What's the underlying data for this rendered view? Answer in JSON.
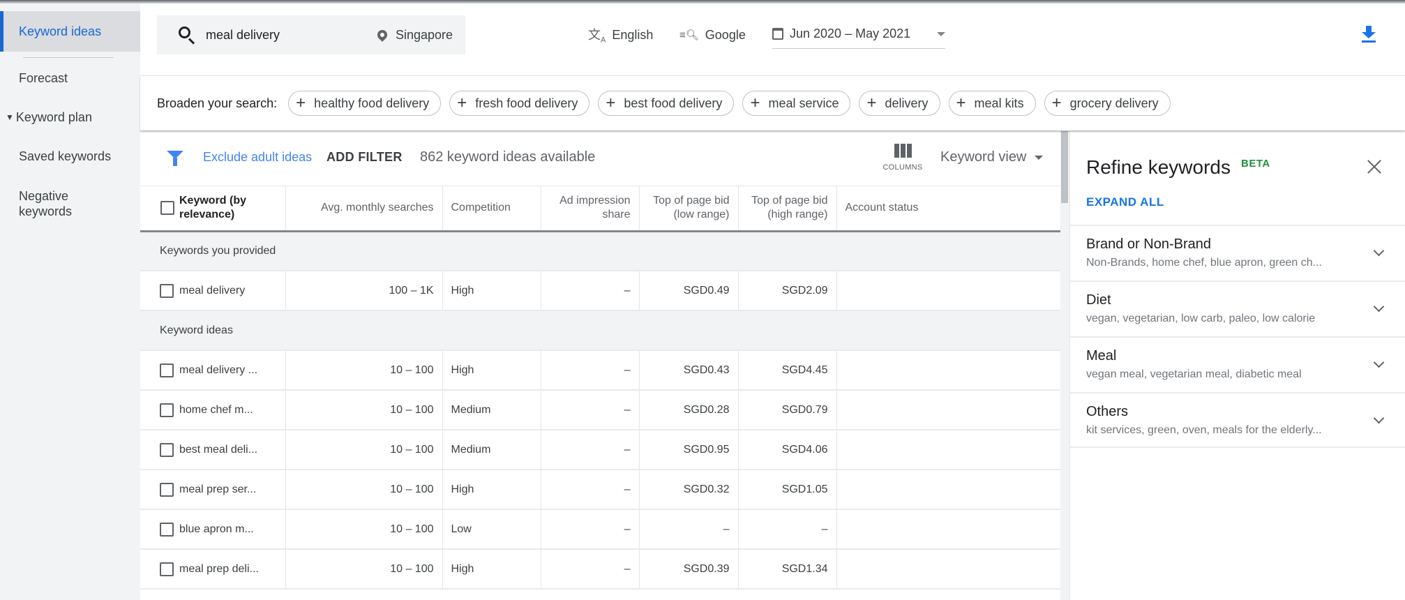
{
  "sidebar": {
    "items": [
      {
        "label": "Keyword ideas",
        "active": true
      },
      {
        "label": "Forecast"
      },
      {
        "label": "Keyword plan",
        "expanded": true
      },
      {
        "label": "Saved keywords"
      },
      {
        "label": "Negative keywords"
      }
    ]
  },
  "topbar": {
    "search_value": "meal delivery",
    "location": "Singapore",
    "language": "English",
    "network": "Google",
    "date_range": "Jun 2020 – May 2021"
  },
  "broaden": {
    "label": "Broaden your search:",
    "chips": [
      "healthy food delivery",
      "fresh food delivery",
      "best food delivery",
      "meal service",
      "delivery",
      "meal kits",
      "grocery delivery"
    ]
  },
  "filterbar": {
    "exclude_adult": "Exclude adult ideas",
    "add_filter": "ADD FILTER",
    "ideas_count": "862 keyword ideas available",
    "columns_label": "COLUMNS",
    "view_label": "Keyword view"
  },
  "table": {
    "headers": [
      "Keyword (by relevance)",
      "Avg. monthly searches",
      "Competition",
      "Ad impression share",
      "Top of page bid (low range)",
      "Top of page bid (high range)",
      "Account status"
    ],
    "groups": [
      {
        "label": "Keywords you provided",
        "rows": [
          {
            "keyword": "meal delivery",
            "searches": "100 – 1K",
            "competition": "High",
            "impression_share": "–",
            "bid_low": "SGD0.49",
            "bid_high": "SGD2.09",
            "status": ""
          }
        ]
      },
      {
        "label": "Keyword ideas",
        "rows": [
          {
            "keyword": "meal delivery ...",
            "searches": "10 – 100",
            "competition": "High",
            "impression_share": "–",
            "bid_low": "SGD0.43",
            "bid_high": "SGD4.45",
            "status": ""
          },
          {
            "keyword": "home chef m...",
            "searches": "10 – 100",
            "competition": "Medium",
            "impression_share": "–",
            "bid_low": "SGD0.28",
            "bid_high": "SGD0.79",
            "status": ""
          },
          {
            "keyword": "best meal deli...",
            "searches": "10 – 100",
            "competition": "Medium",
            "impression_share": "–",
            "bid_low": "SGD0.95",
            "bid_high": "SGD4.06",
            "status": ""
          },
          {
            "keyword": "meal prep ser...",
            "searches": "10 – 100",
            "competition": "High",
            "impression_share": "–",
            "bid_low": "SGD0.32",
            "bid_high": "SGD1.05",
            "status": ""
          },
          {
            "keyword": "blue apron m...",
            "searches": "10 – 100",
            "competition": "Low",
            "impression_share": "–",
            "bid_low": "–",
            "bid_high": "–",
            "status": ""
          },
          {
            "keyword": "meal prep deli...",
            "searches": "10 – 100",
            "competition": "High",
            "impression_share": "–",
            "bid_low": "SGD0.39",
            "bid_high": "SGD1.34",
            "status": ""
          }
        ]
      }
    ]
  },
  "refine": {
    "title": "Refine keywords",
    "badge": "BETA",
    "expand_all": "EXPAND ALL",
    "items": [
      {
        "name": "Brand or Non-Brand",
        "desc": "Non-Brands, home chef, blue apron, green ch..."
      },
      {
        "name": "Diet",
        "desc": "vegan, vegetarian, low carb, paleo, low calorie"
      },
      {
        "name": "Meal",
        "desc": "vegan meal, vegetarian meal, diabetic meal"
      },
      {
        "name": "Others",
        "desc": "kit services, green, oven, meals for the elderly..."
      }
    ]
  },
  "colors": {
    "accent": "#1a73e8",
    "link": "#4285f4",
    "beta": "#1e8e3e",
    "sidebar_bg": "#f1f3f4"
  }
}
